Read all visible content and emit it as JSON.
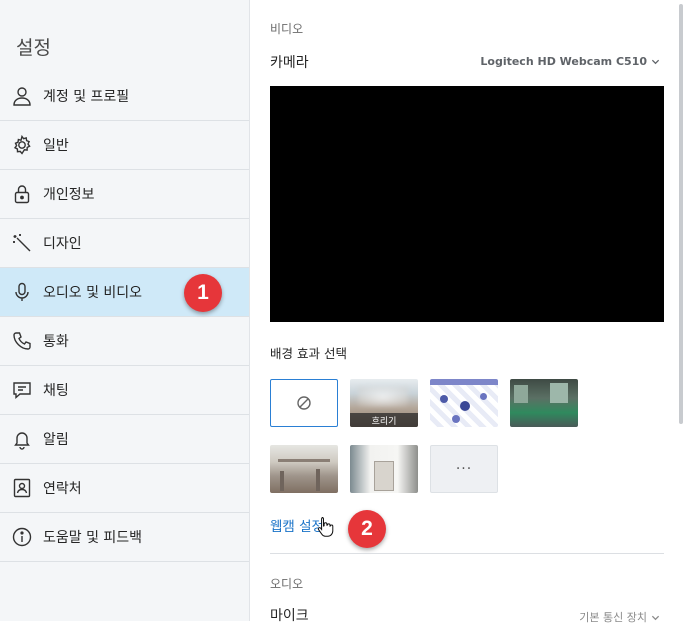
{
  "sidebar": {
    "title": "설정",
    "items": [
      {
        "label": "계정 및 프로필",
        "icon": "person-icon"
      },
      {
        "label": "일반",
        "icon": "gear-icon"
      },
      {
        "label": "개인정보",
        "icon": "lock-icon"
      },
      {
        "label": "디자인",
        "icon": "magic-wand-icon"
      },
      {
        "label": "오디오 및 비디오",
        "icon": "microphone-icon"
      },
      {
        "label": "통화",
        "icon": "phone-icon"
      },
      {
        "label": "채팅",
        "icon": "chat-icon"
      },
      {
        "label": "알림",
        "icon": "bell-icon"
      },
      {
        "label": "연락처",
        "icon": "contact-card-icon"
      },
      {
        "label": "도움말 및 피드백",
        "icon": "info-icon"
      }
    ],
    "active_index": 4
  },
  "annotations": {
    "badge_1": "1",
    "badge_2": "2",
    "badge_color": "#e6363a"
  },
  "video": {
    "section_label": "비디오",
    "camera_label": "카메라",
    "camera_value": "Logitech HD Webcam C510",
    "background_label": "배경 효과 선택",
    "backgrounds": [
      {
        "name": "none",
        "caption": ""
      },
      {
        "name": "blur",
        "caption": "흐리기"
      },
      {
        "name": "pattern",
        "caption": ""
      },
      {
        "name": "office-green",
        "caption": ""
      },
      {
        "name": "office-bright",
        "caption": ""
      },
      {
        "name": "room-interior",
        "caption": ""
      },
      {
        "name": "more",
        "caption": "···"
      }
    ],
    "webcam_settings_link": "웹캠 설정"
  },
  "audio": {
    "section_label": "오디오",
    "mic_label": "마이크",
    "mic_value": "기본 통신 장치"
  },
  "colors": {
    "accent": "#1a73c8",
    "active_bg": "#cfe9f8",
    "sidebar_bg": "#f4f6f8"
  }
}
